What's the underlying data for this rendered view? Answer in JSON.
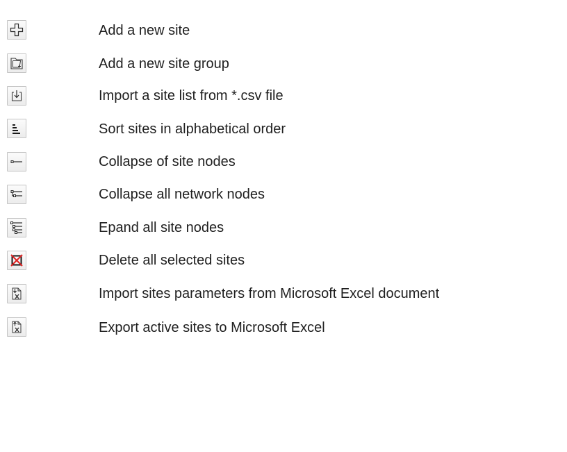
{
  "items": [
    {
      "icon": "add-site-icon",
      "label": "Add a new site"
    },
    {
      "icon": "add-site-group-icon",
      "label": "Add a new site group"
    },
    {
      "icon": "import-csv-icon",
      "label": "Import a site list from *.csv file"
    },
    {
      "icon": "sort-alphabetical-icon",
      "label": "Sort sites in alphabetical order"
    },
    {
      "icon": "collapse-site-nodes-icon",
      "label": "Collapse of site nodes"
    },
    {
      "icon": "collapse-network-nodes-icon",
      "label": "Collapse all network nodes"
    },
    {
      "icon": "expand-site-nodes-icon",
      "label": "Epand all site nodes"
    },
    {
      "icon": "delete-selected-icon",
      "label": "Delete all selected sites"
    },
    {
      "icon": "import-excel-icon",
      "label": "Import sites parameters from Microsoft Excel document"
    },
    {
      "icon": "export-excel-icon",
      "label": "Export active sites to Microsoft Excel"
    }
  ],
  "colors": {
    "delete_icon_red": "#e02020",
    "icon_dark": "#2a2a2a"
  }
}
